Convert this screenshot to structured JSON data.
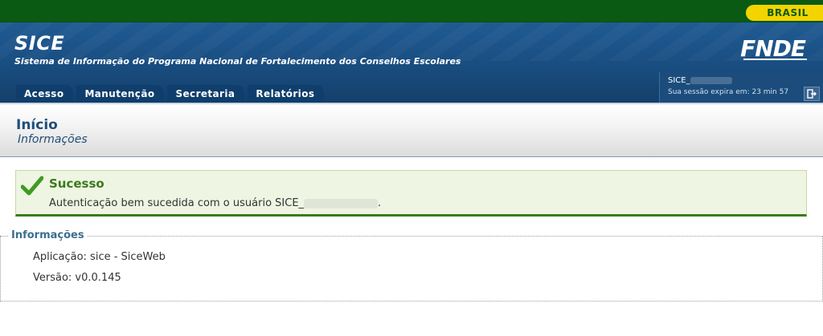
{
  "gov_bar": {
    "brand": "BRASIL"
  },
  "header": {
    "title": "SICE",
    "subtitle": "Sistema de Informação do Programa Nacional de Fortalecimento dos Conselhos Escolares",
    "logo_text": "FNDE"
  },
  "nav": {
    "tabs": [
      {
        "label": "Acesso"
      },
      {
        "label": "Manutenção"
      },
      {
        "label": "Secretaria"
      },
      {
        "label": "Relatórios"
      }
    ]
  },
  "session": {
    "user_prefix": "SICE_",
    "expiry_text": "Sua sessão expira em: 23 min 57"
  },
  "page": {
    "title": "Início",
    "subtitle": "Informações"
  },
  "alert": {
    "title": "Sucesso",
    "message_prefix": "Autenticação bem sucedida com o usuário SICE_",
    "message_suffix": "."
  },
  "info": {
    "legend": "Informações",
    "rows": [
      {
        "text": "Aplicação: sice - SiceWeb"
      },
      {
        "text": "Versão: v0.0.145"
      }
    ]
  },
  "colors": {
    "gov_green": "#0b5a14",
    "brand_yellow": "#f3d400",
    "header_blue": "#1f5b93",
    "success_green": "#3b7a1c"
  }
}
